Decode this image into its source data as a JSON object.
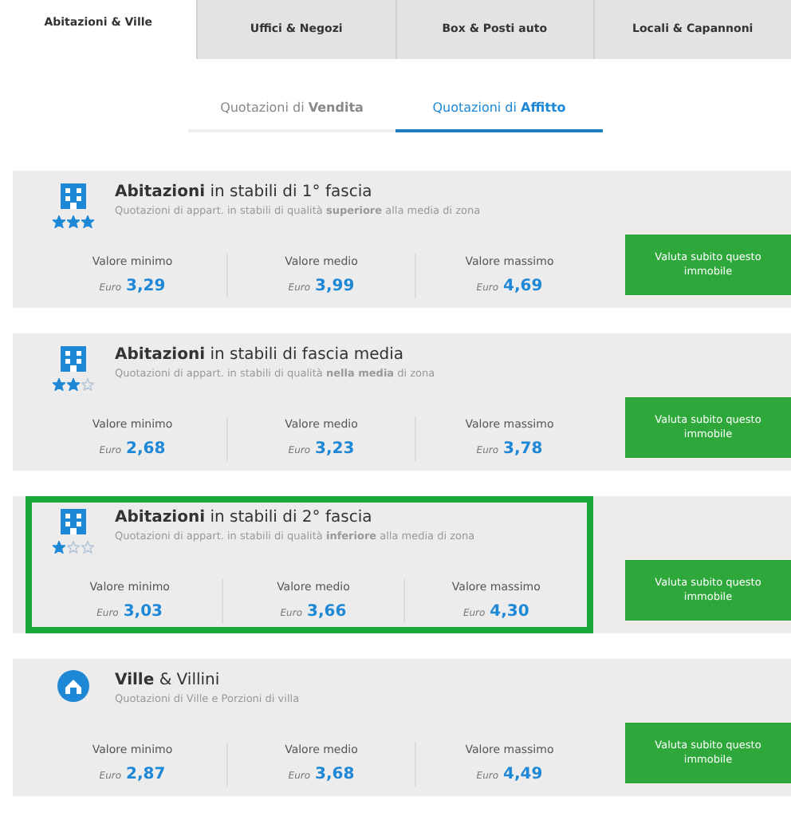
{
  "tabs": [
    {
      "label": "Abitazioni & Ville",
      "selected": true
    },
    {
      "label": "Uffici & Negozi",
      "selected": false
    },
    {
      "label": "Box & Posti auto",
      "selected": false
    },
    {
      "label": "Locali & Capannoni",
      "selected": false
    }
  ],
  "subtabs": [
    {
      "label": "Quotazioni di **Vendita**",
      "selected": false
    },
    {
      "label": "Quotazioni di **Affitto**",
      "selected": true
    }
  ],
  "cards": [
    {
      "kind": "building",
      "title": "**Abitazioni** in stabili di 1° fascia",
      "subtitle": "Quotazioni di appart. in stabili di qualità **superiore** alla media di zona",
      "stars": 3,
      "highlighted": false,
      "values": [
        {
          "label": "Valore minimo",
          "currency": "Euro",
          "amount": "3,29"
        },
        {
          "label": "Valore medio",
          "currency": "Euro",
          "amount": "3,99"
        },
        {
          "label": "Valore massimo",
          "currency": "Euro",
          "amount": "4,69"
        }
      ],
      "button": "Valuta subito questo immobile"
    },
    {
      "kind": "building",
      "title": "**Abitazioni** in stabili di fascia media",
      "subtitle": "Quotazioni di appart. in stabili di qualità **nella media** di zona",
      "stars": 2,
      "highlighted": false,
      "values": [
        {
          "label": "Valore minimo",
          "currency": "Euro",
          "amount": "2,68"
        },
        {
          "label": "Valore medio",
          "currency": "Euro",
          "amount": "3,23"
        },
        {
          "label": "Valore massimo",
          "currency": "Euro",
          "amount": "3,78"
        }
      ],
      "button": "Valuta subito questo immobile"
    },
    {
      "kind": "building",
      "title": "**Abitazioni** in stabili di 2° fascia",
      "subtitle": "Quotazioni di appart. in stabili di qualità **inferiore** alla media di zona",
      "stars": 1,
      "highlighted": true,
      "values": [
        {
          "label": "Valore minimo",
          "currency": "Euro",
          "amount": "3,03"
        },
        {
          "label": "Valore medio",
          "currency": "Euro",
          "amount": "3,66"
        },
        {
          "label": "Valore massimo",
          "currency": "Euro",
          "amount": "4,30"
        }
      ],
      "button": "Valuta subito questo immobile"
    },
    {
      "kind": "villa",
      "title": "**Ville** & Villini",
      "subtitle": "Quotazioni di Ville e Porzioni di villa",
      "highlighted": false,
      "values": [
        {
          "label": "Valore minimo",
          "currency": "Euro",
          "amount": "2,87"
        },
        {
          "label": "Valore medio",
          "currency": "Euro",
          "amount": "3,68"
        },
        {
          "label": "Valore massimo",
          "currency": "Euro",
          "amount": "4,49"
        }
      ],
      "button": "Valuta subito questo immobile"
    }
  ]
}
